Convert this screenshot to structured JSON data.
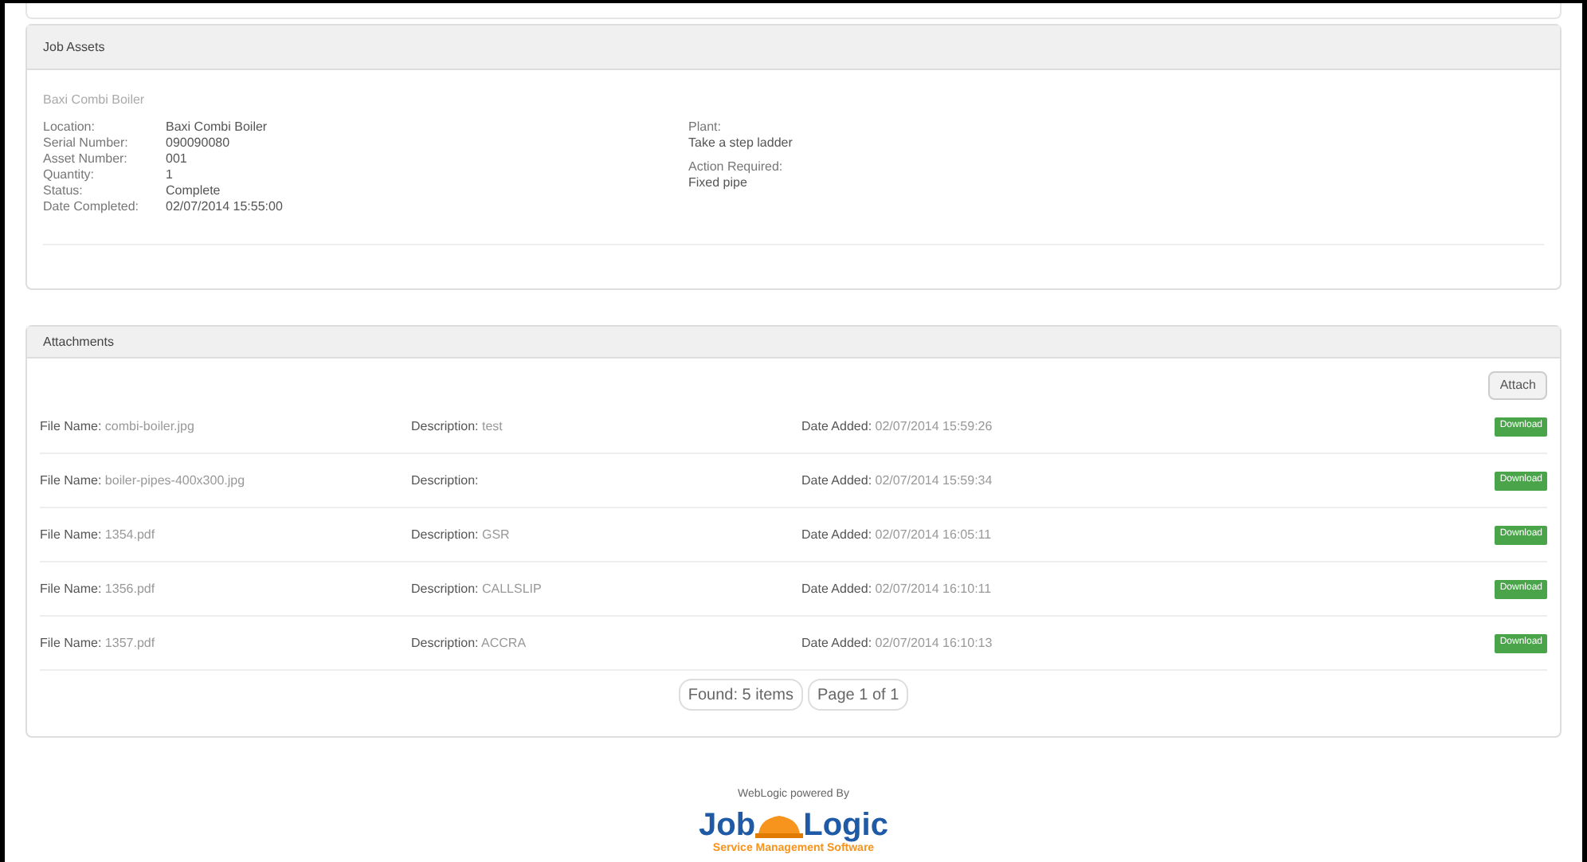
{
  "job_assets": {
    "title": "Job Assets",
    "asset_name": "Baxi Combi Boiler",
    "fields": [
      {
        "label": "Location:",
        "value": "Baxi Combi Boiler"
      },
      {
        "label": "Serial Number:",
        "value": "090090080"
      },
      {
        "label": "Asset Number:",
        "value": "001"
      },
      {
        "label": "Quantity:",
        "value": "1"
      },
      {
        "label": "Status:",
        "value": "Complete"
      },
      {
        "label": "Date Completed:",
        "value": "02/07/2014 15:55:00"
      }
    ],
    "notes": [
      {
        "label": "Plant:",
        "value": "Take a step ladder"
      },
      {
        "label": "Action Required:",
        "value": "Fixed pipe"
      }
    ]
  },
  "attachments": {
    "title": "Attachments",
    "attach_button": "Attach",
    "rows": [
      {
        "file_label": "File Name:",
        "file": "combi-boiler.jpg",
        "desc_label": "Description:",
        "desc": "test",
        "date_label": "Date Added:",
        "date": "02/07/2014 15:59:26",
        "button": "Download"
      },
      {
        "file_label": "File Name:",
        "file": "boiler-pipes-400x300.jpg",
        "desc_label": "Description:",
        "date_label": "Date Added:",
        "date": "02/07/2014 15:59:34",
        "button": "Download"
      },
      {
        "file_label": "File Name:",
        "file": "1354.pdf",
        "desc_label": "Description:",
        "desc": "GSR",
        "date_label": "Date Added:",
        "date": "02/07/2014 16:05:11",
        "button": "Download"
      },
      {
        "file_label": "File Name:",
        "file": "1356.pdf",
        "desc_label": "Description:",
        "desc": "CALLSLIP",
        "date_label": "Date Added:",
        "date": "02/07/2014 16:10:11",
        "button": "Download"
      },
      {
        "file_label": "File Name:",
        "file": "1357.pdf",
        "desc_label": "Description:",
        "desc": "ACCRA",
        "date_label": "Date Added:",
        "date": "02/07/2014 16:10:13",
        "button": "Download"
      }
    ],
    "found": "Found: 5 items",
    "page": "Page 1 of 1"
  },
  "footer": {
    "powered_by": "WebLogic powered By",
    "logo_left": "Job",
    "logo_right": "Logic",
    "tagline": "Service Management Software"
  }
}
